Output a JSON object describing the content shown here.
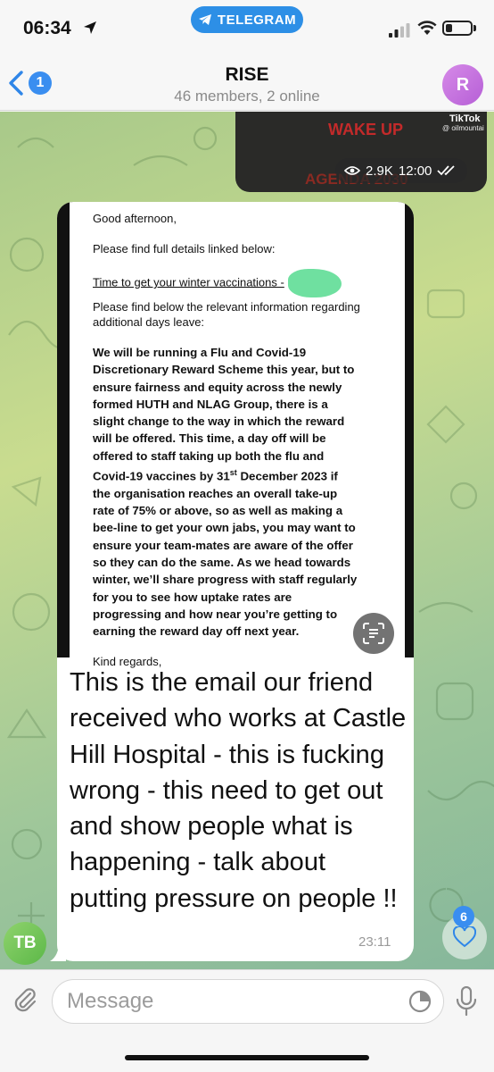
{
  "status_bar": {
    "time": "06:34",
    "return_app": "TELEGRAM"
  },
  "header": {
    "back_unread_count": "1",
    "title": "RISE",
    "subtitle": "46 members, 2 online",
    "avatar_initial": "R"
  },
  "video_preview": {
    "overlay_text_1": "WAKE UP",
    "overlay_text_2": "AGENDA 2030",
    "watermark": "TikTok",
    "watermark_handle": "@ oilmountai",
    "views": "2.9K",
    "time": "12:00",
    "icon": "eye-icon"
  },
  "message": {
    "sender_initials": "TB",
    "email": {
      "greeting": "Good afternoon,",
      "line_1": "Please find full details linked below:",
      "link": "Time to get your winter vaccinations -",
      "line_2": "Please find below the relevant information regarding additional days leave:",
      "body_lines": [
        "We will be running a Flu and Covid-19",
        "Discretionary Reward Scheme this year, but to",
        "ensure fairness and equity across the newly",
        "formed HUTH and NLAG Group, there is a",
        "slight change to the way in which the reward",
        "will be offered. This time, a day off will be",
        "offered to staff taking up both the flu and",
        "Covid-19 vaccines by 31",
        "organisation reaches an overall take-up",
        "rate of 75% or above, so as well as making a",
        "bee-line to get your own jabs, you may want to",
        "ensure your team-mates are aware of the offer",
        "so they can do the same. As we head towards",
        "winter, we’ll share progress with staff regularly",
        "for you to see how uptake rates are",
        "progressing and how near you’re getting to",
        "earning the reward day off next year."
      ],
      "superscript": "st",
      "date_suffix": " December 2023 if",
      "line_8_continuation": "the",
      "sign_off": "Kind regards,"
    },
    "text": "This is the email our friend received who works at Castle Hill Hospital - this is fucking wrong - this need to get out and show people what is happening - talk about putting pressure on people !!",
    "time": "23:11",
    "reaction_count": "6",
    "reaction_icon": "heart-icon"
  },
  "input": {
    "placeholder": "Message"
  },
  "colors": {
    "accent": "#3a8ef0",
    "telegram_pill": "#2d8fe6",
    "sender_avatar": "#6cc353",
    "group_avatar": "#c46fe0"
  }
}
